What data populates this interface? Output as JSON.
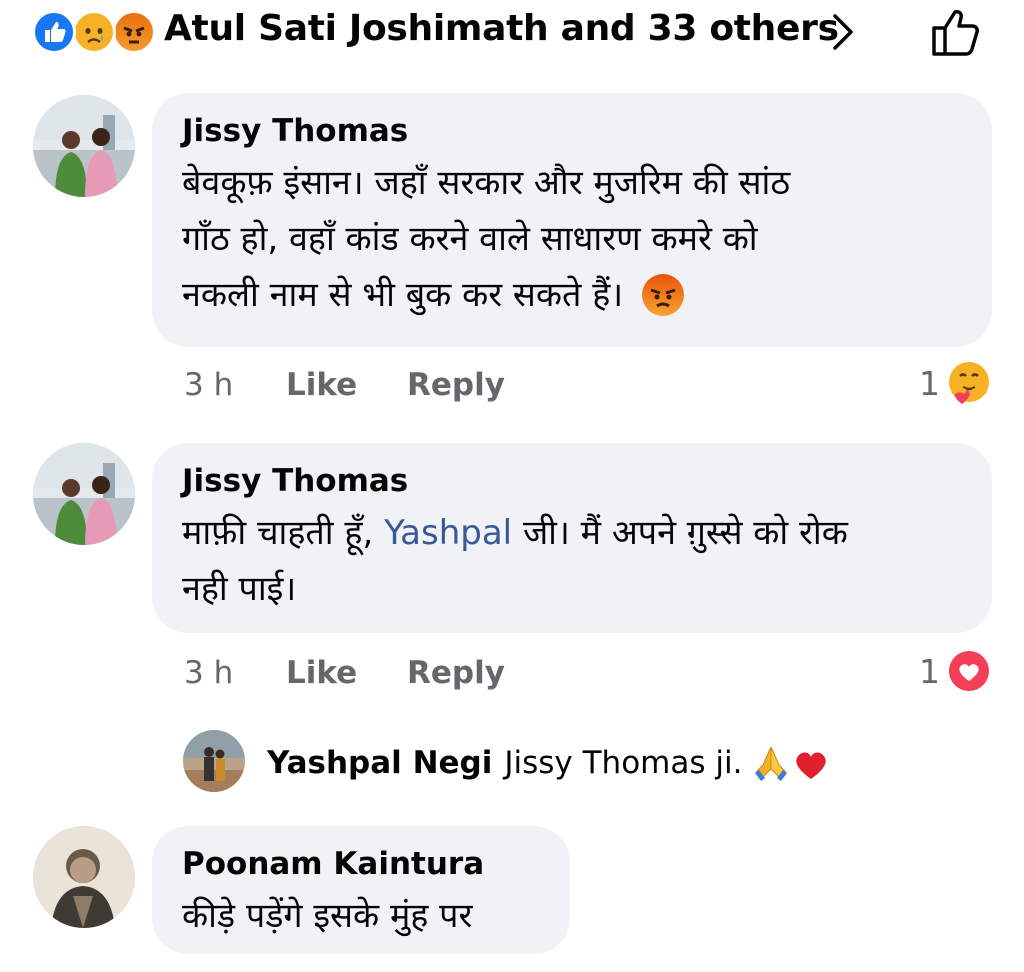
{
  "header": {
    "reactors": "Atul Sati Joshimath and 33 others",
    "reaction_icons": [
      "like-icon",
      "sad-icon",
      "angry-icon"
    ],
    "chevron": "›"
  },
  "comments": [
    {
      "author": "Jissy Thomas",
      "lines": [
        "बेवकूफ़ इंसान। जहाँ सरकार और मुजरिम की सांठ",
        "गाँठ हो, वहाँ कांड करने वाले साधारण कमरे को",
        "नकली नाम से भी बुक कर सकते हैं।"
      ],
      "emoji": "angry-face-emoji",
      "time": "3 h",
      "like": "Like",
      "reply": "Reply",
      "reaction_count": "1",
      "reaction": "care-icon"
    },
    {
      "author": "Jissy Thomas",
      "line1_a": "माफ़ी चाहती हूँ, ",
      "mention": "Yashpal",
      "line1_b": " जी। मैं अपने ग़ुस्से को रोक",
      "line2": "नही पाई।",
      "time": "3 h",
      "like": "Like",
      "reply": "Reply",
      "reaction_count": "1",
      "reaction": "love-icon"
    }
  ],
  "reply": {
    "author": "Yashpal Negi",
    "text": "Jissy Thomas ji.",
    "emojis": [
      "folded-hands-emoji",
      "red-heart-emoji"
    ]
  },
  "comment3": {
    "author": "Poonam Kaintura",
    "text": "कीड़े पड़ेंगे इसके मुंह पर"
  },
  "colors": {
    "bubble": "#f0f2f5",
    "meta": "#65676b",
    "mention": "#385898",
    "like_blue": "#1877f2",
    "love_red": "#f33e58"
  }
}
